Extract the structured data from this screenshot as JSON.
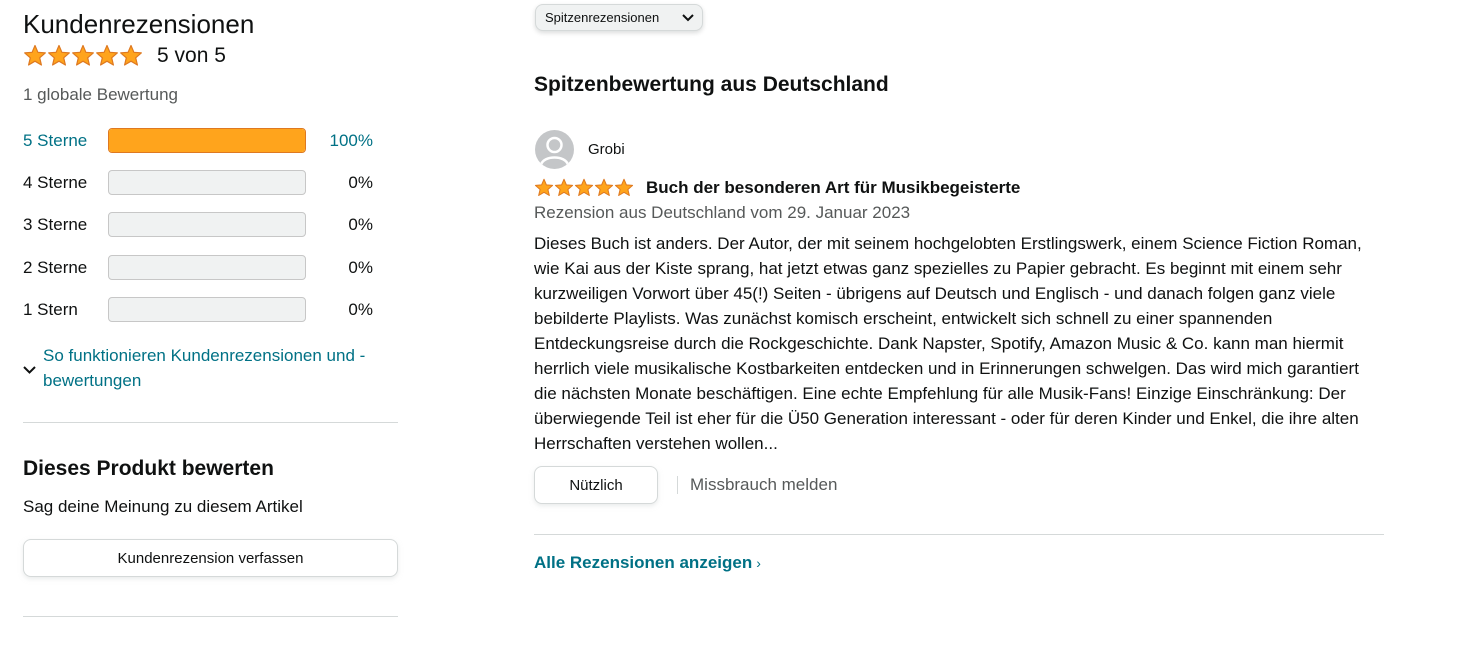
{
  "summary": {
    "title": "Kundenrezensionen",
    "rating": 5,
    "rating_text": "5 von 5",
    "global_count": "1 globale Bewertung"
  },
  "histogram": [
    {
      "label": "5 Sterne",
      "percent_text": "100%",
      "percent": 100
    },
    {
      "label": "4 Sterne",
      "percent_text": "0%",
      "percent": 0
    },
    {
      "label": "3 Sterne",
      "percent_text": "0%",
      "percent": 0
    },
    {
      "label": "2 Sterne",
      "percent_text": "0%",
      "percent": 0
    },
    {
      "label": "1 Stern",
      "percent_text": "0%",
      "percent": 0
    }
  ],
  "how_it_works": "So funktionieren Kundenrezensionen und -bewertungen",
  "rate_product": {
    "title": "Dieses Produkt bewerten",
    "subtitle": "Sag deine Meinung zu diesem Artikel",
    "button": "Kundenrezension verfassen"
  },
  "sort": {
    "selected": "Spitzenrezensionen"
  },
  "section_title": "Spitzenbewertung aus Deutschland",
  "review": {
    "reviewer": "Grobi",
    "rating": 5,
    "title": "Buch der besonderen Art für Musikbegeisterte",
    "meta": "Rezension aus Deutschland vom 29. Januar 2023",
    "body": "Dieses Buch ist anders. Der Autor, der mit seinem hochgelobten Erstlingswerk, einem Science Fiction Roman, wie Kai aus der Kiste sprang, hat jetzt etwas ganz spezielles zu Papier gebracht. Es beginnt mit einem sehr kurzweiligen Vorwort über 45(!) Seiten - übrigens auf Deutsch und Englisch - und danach folgen ganz viele bebilderte Playlists. Was zunächst komisch erscheint, entwickelt sich schnell zu einer spannenden Entdeckungsreise durch die Rockgeschichte. Dank Napster, Spotify, Amazon Music & Co. kann man hiermit herrlich viele musikalische Kostbarkeiten entdecken und in Erinnerungen schwelgen. Das wird mich garantiert die nächsten Monate beschäftigen. Eine echte Empfehlung für alle Musik-Fans! Einzige Einschränkung: Der überwiegende Teil ist eher für die Ü50 Generation interessant - oder für deren Kinder und Enkel, die ihre alten Herrschaften verstehen wollen...",
    "helpful_button": "Nützlich",
    "report_link": "Missbrauch melden"
  },
  "all_reviews_link": "Alle Rezensionen anzeigen",
  "colors": {
    "star": "#ffa41c",
    "star_stroke": "#de7921",
    "link": "#007185",
    "bar_fill": "#ffa41c",
    "bar_bg": "#f0f2f2"
  }
}
